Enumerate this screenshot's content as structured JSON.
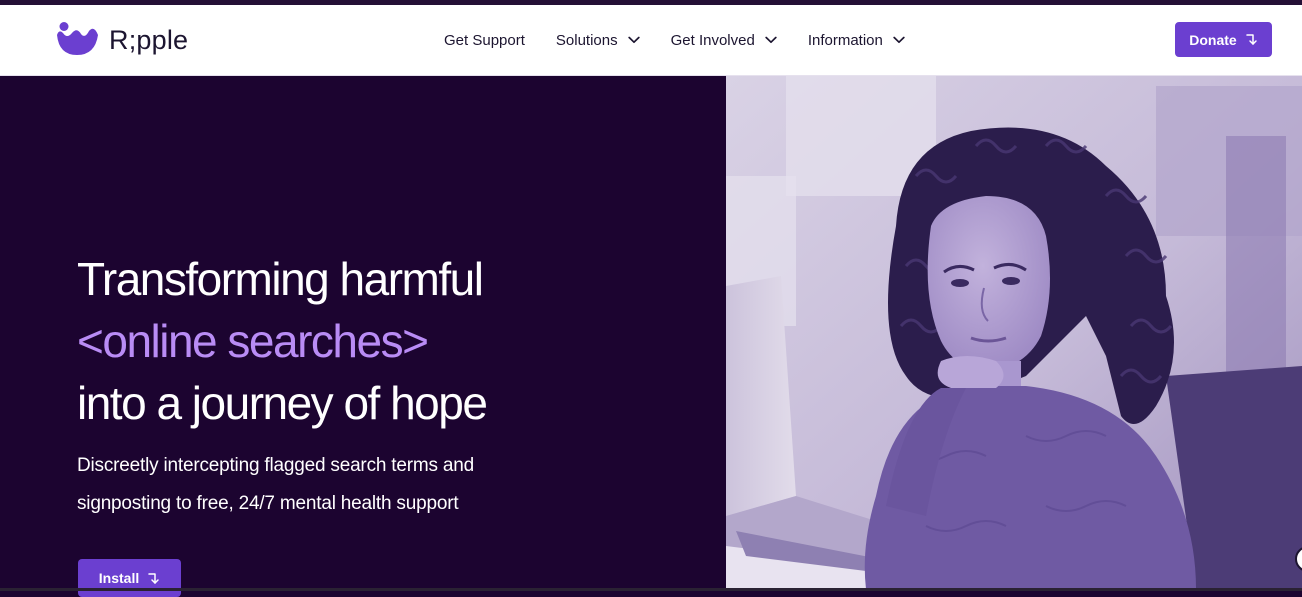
{
  "brand": {
    "name": "R;pple",
    "logo_icon": "ripple-logo-icon",
    "accent_color": "#6b3fd0",
    "highlight_color": "#b98cf5",
    "hero_bg_color": "#1c0430"
  },
  "nav": {
    "items": [
      {
        "label": "Get Support",
        "has_dropdown": false
      },
      {
        "label": "Solutions",
        "has_dropdown": true,
        "icon": "chevron-down-icon"
      },
      {
        "label": "Get Involved",
        "has_dropdown": true,
        "icon": "chevron-down-icon"
      },
      {
        "label": "Information",
        "has_dropdown": true,
        "icon": "chevron-down-icon"
      }
    ],
    "donate_label": "Donate",
    "donate_icon": "arrow-down-right-icon"
  },
  "hero": {
    "headline_line1": "Transforming harmful",
    "headline_line2": "<online searches>",
    "headline_line3": "into a journey of hope",
    "subtext": "Discreetly intercepting flagged search terms and signposting to free, 24/7 mental health support",
    "install_label": "Install",
    "install_icon": "arrow-down-right-icon"
  }
}
